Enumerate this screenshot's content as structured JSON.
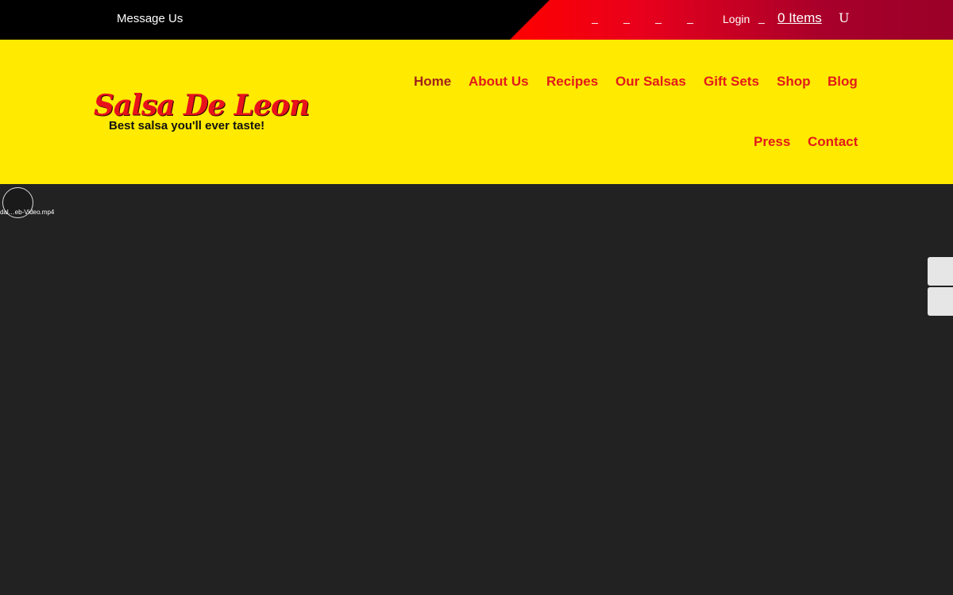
{
  "topbar": {
    "message_label": "Message Us",
    "social_icons": [
      {
        "name": "facebook-icon",
        "glyph": "_"
      },
      {
        "name": "twitter-icon",
        "glyph": "_"
      },
      {
        "name": "instagram-icon",
        "glyph": "_"
      },
      {
        "name": "youtube-icon",
        "glyph": "_"
      }
    ],
    "login_label": "Login",
    "cart_glyph": "_",
    "items_label": "0 Items",
    "user_glyph": "U",
    "colors": {
      "bar": "#000000",
      "accent_start": "#ff0000",
      "accent_end": "#9a0028"
    }
  },
  "header": {
    "logo_title": "Salsa De Leon",
    "logo_tagline": "Best salsa you'll ever taste!",
    "background": "#ffea00",
    "nav": [
      {
        "label": "Home",
        "active": true
      },
      {
        "label": "About Us"
      },
      {
        "label": "Recipes"
      },
      {
        "label": "Our Salsas"
      },
      {
        "label": "Gift Sets"
      },
      {
        "label": "Shop"
      },
      {
        "label": "Blog"
      },
      {
        "label": "Press"
      },
      {
        "label": "Contact"
      }
    ]
  },
  "video": {
    "file_label": "dal…eb-Video.mp4",
    "background": "#222222"
  }
}
